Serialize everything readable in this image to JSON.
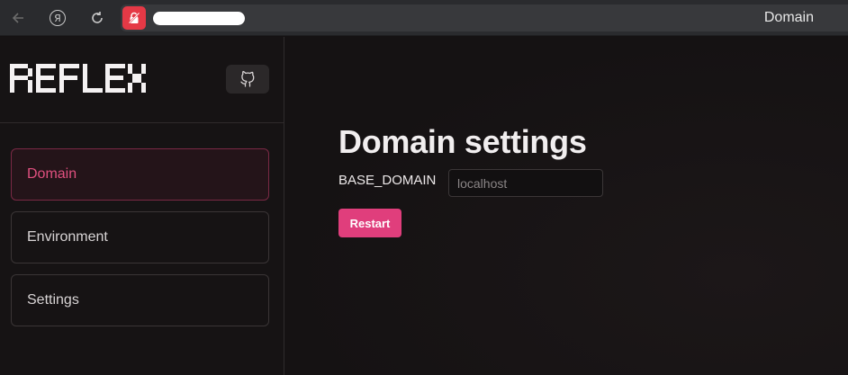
{
  "browser": {
    "tab_title": "Domain",
    "icons": {
      "back": "back-arrow-icon",
      "yandex": "yandex-icon",
      "yandex_glyph": "Я",
      "reload": "reload-icon",
      "site": "site-blocked-icon"
    }
  },
  "sidebar": {
    "logo_text": "REFLEX",
    "github_icon": "github-icon",
    "items": [
      {
        "label": "Domain",
        "active": true
      },
      {
        "label": "Environment",
        "active": false
      },
      {
        "label": "Settings",
        "active": false
      }
    ]
  },
  "main": {
    "title": "Domain settings",
    "field": {
      "label": "BASE_DOMAIN",
      "value": "",
      "placeholder": "localhost"
    },
    "restart_label": "Restart"
  },
  "colors": {
    "accent": "#e03e7c",
    "active_text": "#e0507f",
    "background": "#151213"
  }
}
